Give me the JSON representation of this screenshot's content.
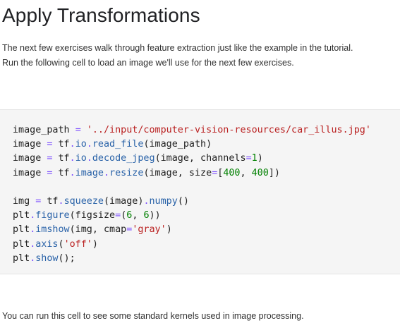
{
  "heading": "Apply Transformations",
  "intro": {
    "line1": "The next few exercises walk through feature extraction just like the example in the tutorial.",
    "line2": "Run the following cell to load an image we'll use for the next few exercises."
  },
  "code_lines": [
    [
      {
        "t": "image_path",
        "c": "t-var"
      },
      {
        "t": " ",
        "c": "t-var"
      },
      {
        "t": "=",
        "c": "t-op"
      },
      {
        "t": " ",
        "c": "t-var"
      },
      {
        "t": "'../input/computer-vision-resources/car_illus.jpg'",
        "c": "t-str"
      }
    ],
    [
      {
        "t": "image",
        "c": "t-var"
      },
      {
        "t": " ",
        "c": "t-var"
      },
      {
        "t": "=",
        "c": "t-op"
      },
      {
        "t": " tf",
        "c": "t-var"
      },
      {
        "t": ".",
        "c": "t-op"
      },
      {
        "t": "io",
        "c": "t-attr"
      },
      {
        "t": ".",
        "c": "t-op"
      },
      {
        "t": "read_file",
        "c": "t-attr"
      },
      {
        "t": "(image_path)",
        "c": "t-punc"
      }
    ],
    [
      {
        "t": "image",
        "c": "t-var"
      },
      {
        "t": " ",
        "c": "t-var"
      },
      {
        "t": "=",
        "c": "t-op"
      },
      {
        "t": " tf",
        "c": "t-var"
      },
      {
        "t": ".",
        "c": "t-op"
      },
      {
        "t": "io",
        "c": "t-attr"
      },
      {
        "t": ".",
        "c": "t-op"
      },
      {
        "t": "decode_jpeg",
        "c": "t-attr"
      },
      {
        "t": "(image, channels",
        "c": "t-punc"
      },
      {
        "t": "=",
        "c": "t-op"
      },
      {
        "t": "1",
        "c": "t-num"
      },
      {
        "t": ")",
        "c": "t-punc"
      }
    ],
    [
      {
        "t": "image",
        "c": "t-var"
      },
      {
        "t": " ",
        "c": "t-var"
      },
      {
        "t": "=",
        "c": "t-op"
      },
      {
        "t": " tf",
        "c": "t-var"
      },
      {
        "t": ".",
        "c": "t-op"
      },
      {
        "t": "image",
        "c": "t-attr"
      },
      {
        "t": ".",
        "c": "t-op"
      },
      {
        "t": "resize",
        "c": "t-attr"
      },
      {
        "t": "(image, size",
        "c": "t-punc"
      },
      {
        "t": "=",
        "c": "t-op"
      },
      {
        "t": "[",
        "c": "t-punc"
      },
      {
        "t": "400",
        "c": "t-num"
      },
      {
        "t": ", ",
        "c": "t-punc"
      },
      {
        "t": "400",
        "c": "t-num"
      },
      {
        "t": "])",
        "c": "t-punc"
      }
    ],
    [],
    [
      {
        "t": "img",
        "c": "t-var"
      },
      {
        "t": " ",
        "c": "t-var"
      },
      {
        "t": "=",
        "c": "t-op"
      },
      {
        "t": " tf",
        "c": "t-var"
      },
      {
        "t": ".",
        "c": "t-op"
      },
      {
        "t": "squeeze",
        "c": "t-attr"
      },
      {
        "t": "(image)",
        "c": "t-punc"
      },
      {
        "t": ".",
        "c": "t-op"
      },
      {
        "t": "numpy",
        "c": "t-attr"
      },
      {
        "t": "()",
        "c": "t-punc"
      }
    ],
    [
      {
        "t": "plt",
        "c": "t-var"
      },
      {
        "t": ".",
        "c": "t-op"
      },
      {
        "t": "figure",
        "c": "t-attr"
      },
      {
        "t": "(figsize",
        "c": "t-punc"
      },
      {
        "t": "=",
        "c": "t-op"
      },
      {
        "t": "(",
        "c": "t-punc"
      },
      {
        "t": "6",
        "c": "t-num"
      },
      {
        "t": ", ",
        "c": "t-punc"
      },
      {
        "t": "6",
        "c": "t-num"
      },
      {
        "t": "))",
        "c": "t-punc"
      }
    ],
    [
      {
        "t": "plt",
        "c": "t-var"
      },
      {
        "t": ".",
        "c": "t-op"
      },
      {
        "t": "imshow",
        "c": "t-attr"
      },
      {
        "t": "(img, cmap",
        "c": "t-punc"
      },
      {
        "t": "=",
        "c": "t-op"
      },
      {
        "t": "'gray'",
        "c": "t-str"
      },
      {
        "t": ")",
        "c": "t-punc"
      }
    ],
    [
      {
        "t": "plt",
        "c": "t-var"
      },
      {
        "t": ".",
        "c": "t-op"
      },
      {
        "t": "axis",
        "c": "t-attr"
      },
      {
        "t": "(",
        "c": "t-punc"
      },
      {
        "t": "'off'",
        "c": "t-str"
      },
      {
        "t": ")",
        "c": "t-punc"
      }
    ],
    [
      {
        "t": "plt",
        "c": "t-var"
      },
      {
        "t": ".",
        "c": "t-op"
      },
      {
        "t": "show",
        "c": "t-attr"
      },
      {
        "t": "();",
        "c": "t-punc"
      }
    ]
  ],
  "outro": "You can run this cell to see some standard kernels used in image processing.",
  "colors": {
    "code_background": "#f5f5f5",
    "operator": "#7c4dff",
    "attribute": "#2962a8",
    "string": "#ba2121",
    "number": "#008000"
  }
}
